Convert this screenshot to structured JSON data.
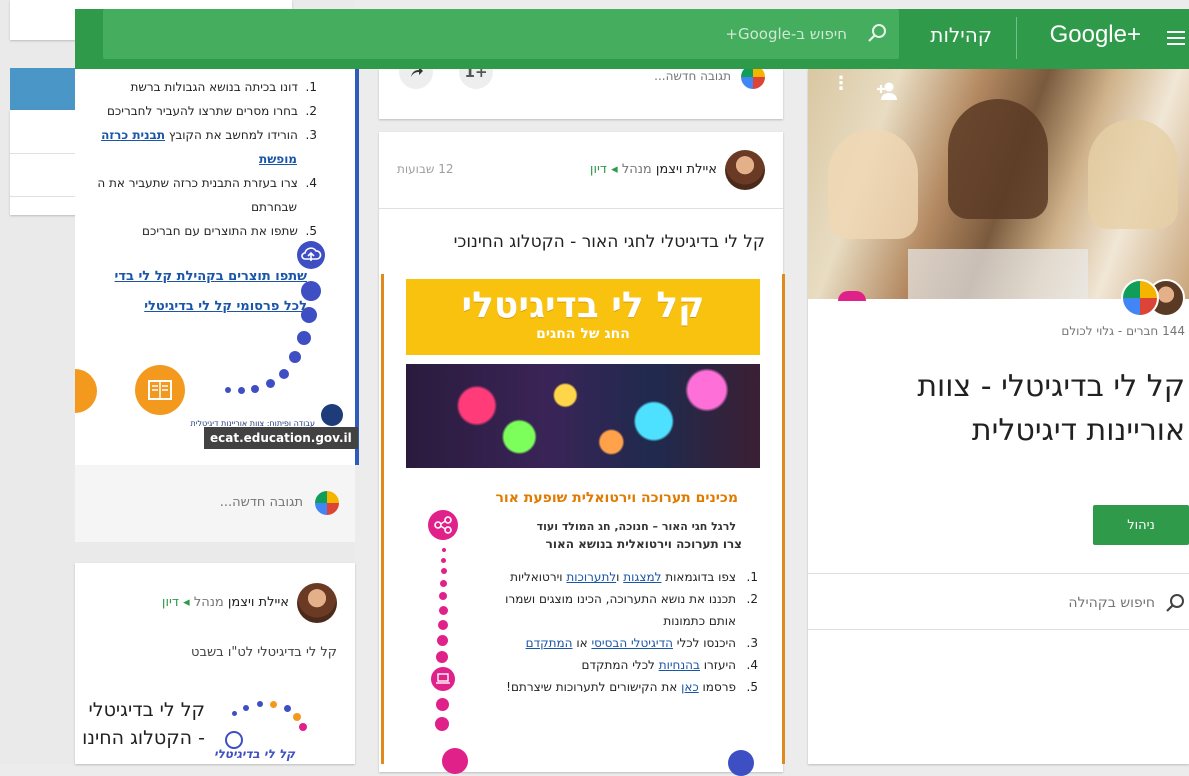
{
  "topbar": {
    "logo": "Google+",
    "communities": "קהילות",
    "search_placeholder": "חיפוש ב-Google+"
  },
  "left_column": {
    "header_fragment": "לה",
    "list": [
      {
        "n": "1.",
        "text": "דונו בכיתה בנושא הגבולות ברשת"
      },
      {
        "n": "2.",
        "text": "בחרו מסרים שתרצו להעביר לחבריכם"
      },
      {
        "n": "3.",
        "text": "הורידו למחשב את הקובץ",
        "link": "תבנית כרזה",
        "link2": "מופשת"
      },
      {
        "n": "4.",
        "text": "צרו בעזרת התבנית כרזה שתעביר את ה",
        "text2": "שבחרתם"
      },
      {
        "n": "5.",
        "text": "שתפו את התוצרים עם חבריכם"
      }
    ],
    "link_share": "שתפו תוצרים בקהילת קל לי בדי",
    "link_all": "לכל פרסומי קל לי בדיגיטלי",
    "small_caption": "עבודה ופיתוח: צוות אוריינות דיגיטלית",
    "small_caption2": "מיומנויות דיגיטליות בהוראה במא",
    "url_tag": "ecat.education.gov.il",
    "reply_placeholder": "תגובה חדשה...",
    "post2": {
      "author": "איילת ויצמן",
      "role": "מנהל",
      "category": "דיון",
      "text": "קל לי בדיגיטלי לט\"ו בשבט",
      "big_title_line1": "קל לי בדיגיטלי",
      "big_title_line2": "- הקטלוג החינו",
      "logo_text": "קל לי בדיגיטלי"
    }
  },
  "center_column": {
    "mini_reply_placeholder": "תגובה חדשה...",
    "plus_one": "+1",
    "post": {
      "author": "איילת ויצמן",
      "role": "מנהל",
      "category": "דיון",
      "time": "12 שבועות",
      "title": "קל לי בדיגיטלי לחגי האור - הקטלוג החינוכי",
      "poster": {
        "banner_title": "קל לי בדיגיטלי",
        "banner_subtitle": "החג של החגים",
        "heading": "מכינים תערוכה וירטואלית שופעת אור",
        "intro1": "לרגל חגי האור – חנוכה, חג המולד ועוד",
        "intro2": "צרו תערוכה וירטואלית בנושא האור",
        "steps": [
          {
            "n": "1.",
            "a": "צפו בדוגמאות ",
            "l1": "למצגות",
            "b": " ו",
            "l2": "לתערוכות",
            "c": " וירטואליות"
          },
          {
            "n": "2.",
            "a": "תכננו את נושא התערוכה, הכינו מוצגים ושמרו"
          },
          {
            "n": "",
            "a": "אותם כתמונות"
          },
          {
            "n": "3.",
            "a": "היכנסו לכלי ",
            "l1": "הדיגיטלי הבסיסי",
            "b": " או ",
            "l2": "המתקדם"
          },
          {
            "n": "4.",
            "a": "היעזרו ",
            "l1": "בהנחיות",
            "b": " לכלי המתקדם"
          },
          {
            "n": "5.",
            "a": "פרסמו ",
            "l1": "כאן",
            "b": " את הקישורים לתערוכות שיצרתם!"
          }
        ]
      }
    }
  },
  "community": {
    "members": "144 חברים - גלוי לכולם",
    "title_line1": "קל לי בדיגיטלי - צוות",
    "title_line2": "אוריינות דיגיטלית",
    "manage": "ניהול",
    "search_placeholder": "חיפוש בקהילה"
  },
  "colors": {
    "brand_green": "#2e9a4a",
    "link_blue": "#1a55a8",
    "poster_orange": "#e08a1e",
    "banner_yellow": "#f8c20f",
    "pink": "#e0218a"
  }
}
